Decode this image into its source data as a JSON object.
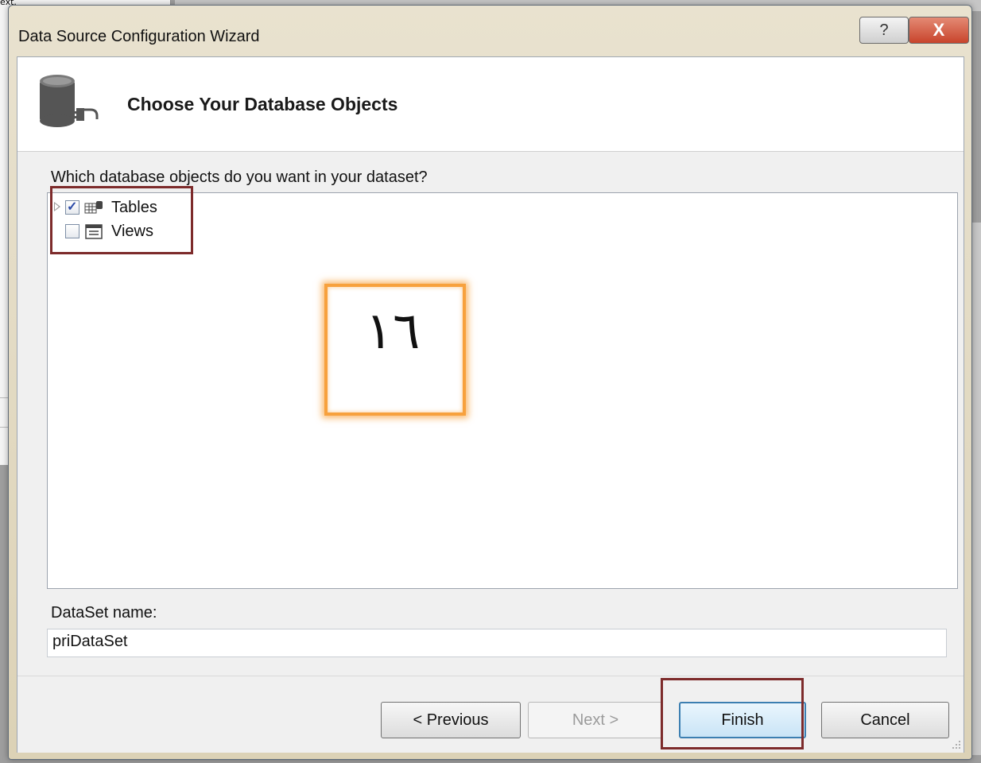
{
  "background": {
    "text": "ext."
  },
  "dialog": {
    "title": "Data Source Configuration Wizard",
    "help_label": "?",
    "close_label": "X",
    "header_title": "Choose Your Database Objects",
    "question": "Which database objects do you want in your dataset?",
    "tree": [
      {
        "label": "Tables",
        "checked": true,
        "icon": "table-icon"
      },
      {
        "label": "Views",
        "checked": false,
        "icon": "view-icon"
      }
    ],
    "annotation_label": "١٦",
    "dataset_label": "DataSet name:",
    "dataset_value": "priDataSet",
    "buttons": {
      "previous": "< Previous",
      "next": "Next >",
      "finish": "Finish",
      "cancel": "Cancel"
    }
  },
  "colors": {
    "highlight_red": "#7d2b2b",
    "highlight_orange": "#f7a13d",
    "close_red": "#c8442c"
  }
}
